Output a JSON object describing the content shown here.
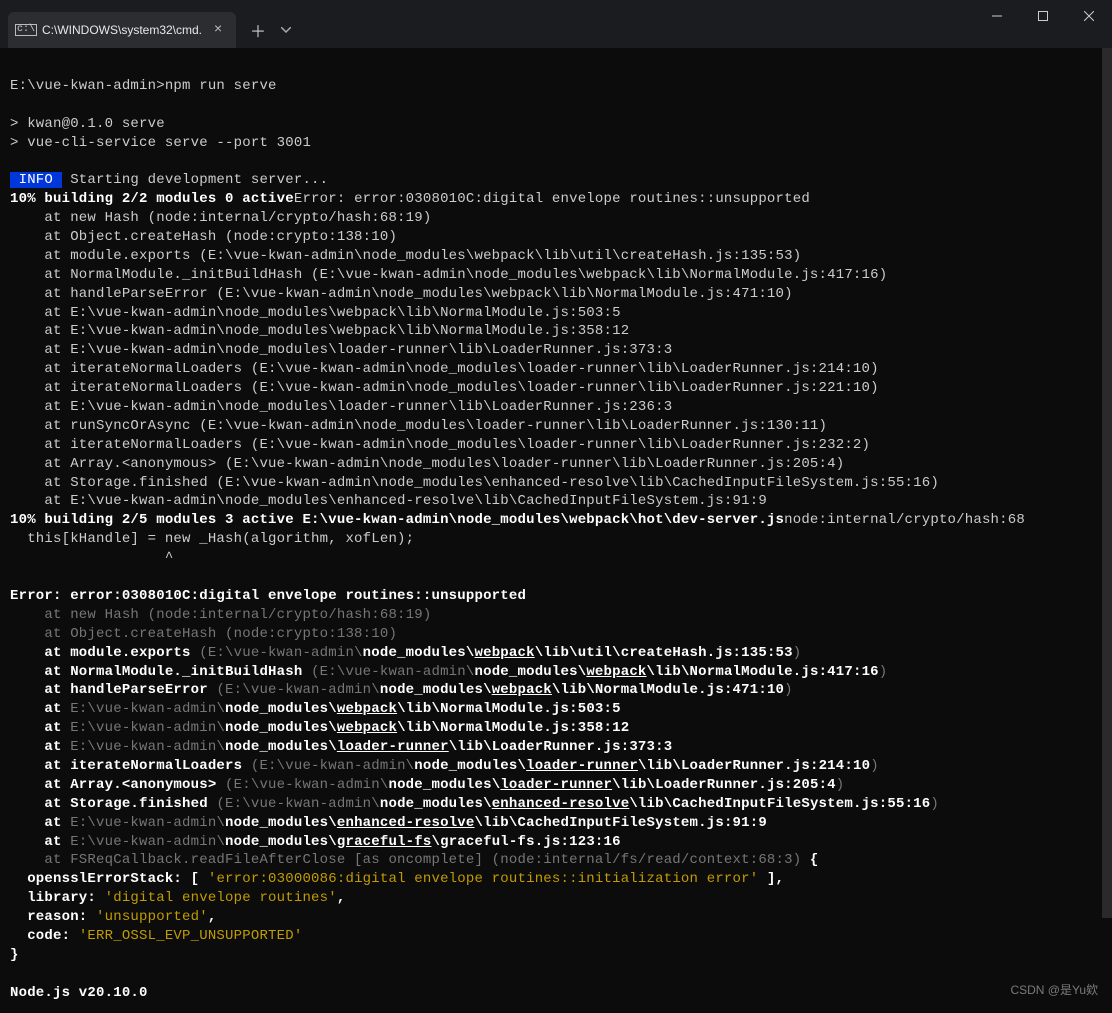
{
  "titlebar": {
    "tab_title": "C:\\WINDOWS\\system32\\cmd."
  },
  "terminal": {
    "prompt": "E:\\vue-kwan-admin>npm run serve",
    "line_pkg": "> kwan@0.1.0 serve",
    "line_cmd": "> vue-cli-service serve --port 3001",
    "info_badge": " INFO ",
    "info_msg": " Starting development server...",
    "build1": "10% building 2/2 modules 0 active",
    "build1_err": "Error: error:0308010C:digital envelope routines::unsupported",
    "stack1": [
      "    at new Hash (node:internal/crypto/hash:68:19)",
      "    at Object.createHash (node:crypto:138:10)",
      "    at module.exports (E:\\vue-kwan-admin\\node_modules\\webpack\\lib\\util\\createHash.js:135:53)",
      "    at NormalModule._initBuildHash (E:\\vue-kwan-admin\\node_modules\\webpack\\lib\\NormalModule.js:417:16)",
      "    at handleParseError (E:\\vue-kwan-admin\\node_modules\\webpack\\lib\\NormalModule.js:471:10)",
      "    at E:\\vue-kwan-admin\\node_modules\\webpack\\lib\\NormalModule.js:503:5",
      "    at E:\\vue-kwan-admin\\node_modules\\webpack\\lib\\NormalModule.js:358:12",
      "    at E:\\vue-kwan-admin\\node_modules\\loader-runner\\lib\\LoaderRunner.js:373:3",
      "    at iterateNormalLoaders (E:\\vue-kwan-admin\\node_modules\\loader-runner\\lib\\LoaderRunner.js:214:10)",
      "    at iterateNormalLoaders (E:\\vue-kwan-admin\\node_modules\\loader-runner\\lib\\LoaderRunner.js:221:10)",
      "    at E:\\vue-kwan-admin\\node_modules\\loader-runner\\lib\\LoaderRunner.js:236:3",
      "    at runSyncOrAsync (E:\\vue-kwan-admin\\node_modules\\loader-runner\\lib\\LoaderRunner.js:130:11)",
      "    at iterateNormalLoaders (E:\\vue-kwan-admin\\node_modules\\loader-runner\\lib\\LoaderRunner.js:232:2)",
      "    at Array.<anonymous> (E:\\vue-kwan-admin\\node_modules\\loader-runner\\lib\\LoaderRunner.js:205:4)",
      "    at Storage.finished (E:\\vue-kwan-admin\\node_modules\\enhanced-resolve\\lib\\CachedInputFileSystem.js:55:16)",
      "    at E:\\vue-kwan-admin\\node_modules\\enhanced-resolve\\lib\\CachedInputFileSystem.js:91:9"
    ],
    "build2": "10% building 2/5 modules 3 active E:\\vue-kwan-admin\\node_modules\\webpack\\hot\\dev-server.js",
    "build2_tail": "node:internal/crypto/hash:68",
    "throw_line": "  this[kHandle] = new _Hash(algorithm, xofLen);",
    "throw_caret": "                  ^",
    "err2_title": "Error: error:0308010C:digital envelope routines::unsupported",
    "s2": {
      "l1": "    at new Hash (node:internal/crypto/hash:68:19)",
      "l2": "    at Object.createHash (node:crypto:138:10)",
      "l3_a": "    at module.exports ",
      "l3_b": "(E:\\vue-kwan-admin\\",
      "l3_c": "node_modules\\",
      "l3_d": "webpack",
      "l3_e": "\\lib\\util\\createHash.js:135:53",
      "l3_f": ")",
      "l4_a": "    at NormalModule._initBuildHash ",
      "l4_b": "(E:\\vue-kwan-admin\\",
      "l4_c": "node_modules\\",
      "l4_d": "webpack",
      "l4_e": "\\lib\\NormalModule.js:417:16",
      "l4_f": ")",
      "l5_a": "    at handleParseError ",
      "l5_b": "(E:\\vue-kwan-admin\\",
      "l5_c": "node_modules\\",
      "l5_d": "webpack",
      "l5_e": "\\lib\\NormalModule.js:471:10",
      "l5_f": ")",
      "l6_a": "    at ",
      "l6_b": "E:\\vue-kwan-admin\\",
      "l6_c": "node_modules\\",
      "l6_d": "webpack",
      "l6_e": "\\lib\\NormalModule.js:503:5",
      "l7_a": "    at ",
      "l7_b": "E:\\vue-kwan-admin\\",
      "l7_c": "node_modules\\",
      "l7_d": "webpack",
      "l7_e": "\\lib\\NormalModule.js:358:12",
      "l8_a": "    at ",
      "l8_b": "E:\\vue-kwan-admin\\",
      "l8_c": "node_modules\\",
      "l8_d": "loader-runner",
      "l8_e": "\\lib\\LoaderRunner.js:373:3",
      "l9_a": "    at iterateNormalLoaders ",
      "l9_b": "(E:\\vue-kwan-admin\\",
      "l9_c": "node_modules\\",
      "l9_d": "loader-runner",
      "l9_e": "\\lib\\LoaderRunner.js:214:10",
      "l9_f": ")",
      "l10_a": "    at Array.<anonymous> ",
      "l10_b": "(E:\\vue-kwan-admin\\",
      "l10_c": "node_modules\\",
      "l10_d": "loader-runner",
      "l10_e": "\\lib\\LoaderRunner.js:205:4",
      "l10_f": ")",
      "l11_a": "    at Storage.finished ",
      "l11_b": "(E:\\vue-kwan-admin\\",
      "l11_c": "node_modules\\",
      "l11_d": "enhanced-resolve",
      "l11_e": "\\lib\\CachedInputFileSystem.js:55:16",
      "l11_f": ")",
      "l12_a": "    at ",
      "l12_b": "E:\\vue-kwan-admin\\",
      "l12_c": "node_modules\\",
      "l12_d": "enhanced-resolve",
      "l12_e": "\\lib\\CachedInputFileSystem.js:91:9",
      "l13_a": "    at ",
      "l13_b": "E:\\vue-kwan-admin\\",
      "l13_c": "node_modules\\",
      "l13_d": "graceful-fs",
      "l13_e": "\\graceful-fs.js:123:16",
      "l14": "    at FSReqCallback.readFileAfterClose [as oncomplete] (node:internal/fs/read/context:68:3)",
      "l14_b": " {"
    },
    "obj": {
      "stack_label": "  opensslErrorStack: [ ",
      "stack_val": "'error:03000086:digital envelope routines::initialization error'",
      "stack_close": " ],",
      "lib_label": "  library: ",
      "lib_val": "'digital envelope routines'",
      "comma": ",",
      "reason_label": "  reason: ",
      "reason_val": "'unsupported'",
      "code_label": "  code: ",
      "code_val": "'ERR_OSSL_EVP_UNSUPPORTED'",
      "brace_close": "}"
    },
    "node_ver": "Node.js v20.10.0"
  },
  "watermark": "CSDN @是Yu欸"
}
